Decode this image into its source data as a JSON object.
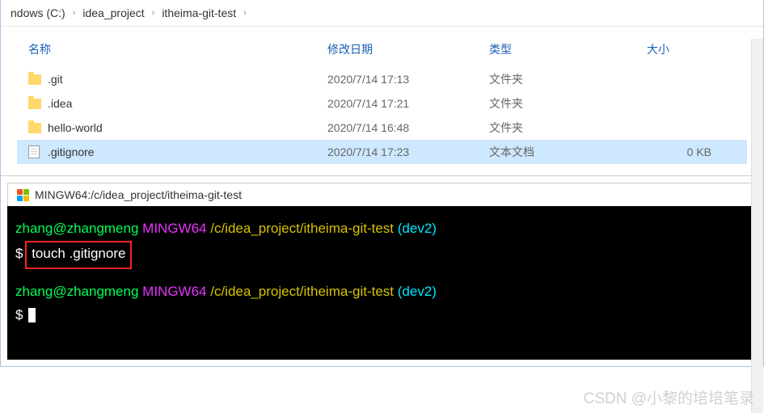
{
  "breadcrumb": {
    "parts": [
      "ndows (C:)",
      "idea_project",
      "itheima-git-test"
    ]
  },
  "headers": {
    "name": "名称",
    "date": "修改日期",
    "type": "类型",
    "size": "大小"
  },
  "files": [
    {
      "name": ".git",
      "date": "2020/7/14 17:13",
      "type": "文件夹",
      "size": "",
      "icon": "folder",
      "selected": false
    },
    {
      "name": ".idea",
      "date": "2020/7/14 17:21",
      "type": "文件夹",
      "size": "",
      "icon": "folder",
      "selected": false
    },
    {
      "name": "hello-world",
      "date": "2020/7/14 16:48",
      "type": "文件夹",
      "size": "",
      "icon": "folder",
      "selected": false
    },
    {
      "name": ".gitignore",
      "date": "2020/7/14 17:23",
      "type": "文本文档",
      "size": "0 KB",
      "icon": "file",
      "selected": true
    }
  ],
  "terminal": {
    "title": "MINGW64:/c/idea_project/itheima-git-test",
    "user": "zhang@zhangmeng",
    "host": "MINGW64",
    "path": "/c/idea_project/itheima-git-test",
    "branch": "(dev2)",
    "dollar": "$",
    "cmd": "touch .gitignore"
  },
  "watermark": "CSDN @小黎的培培笔录"
}
